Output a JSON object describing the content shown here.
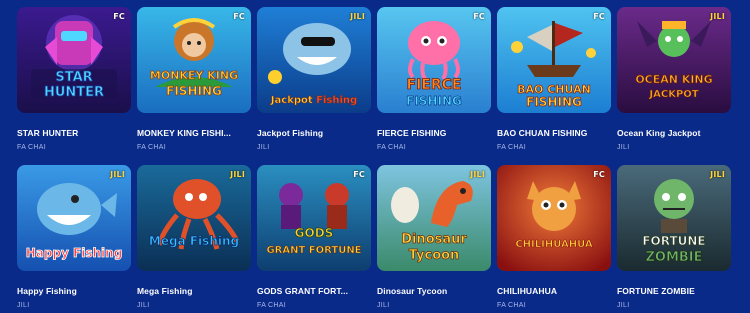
{
  "games": [
    {
      "title": "STAR HUNTER",
      "provider": "FA CHAI",
      "badge": "FC",
      "logo_line1": "STAR",
      "logo_line2": "HUNTER",
      "colors": {
        "bg1": "#3b1a8f",
        "bg2": "#1a0f4a",
        "accent": "#e64bd6",
        "logo": "#4fd8ff"
      }
    },
    {
      "title": "MONKEY KING FISHI...",
      "provider": "FA CHAI",
      "badge": "FC",
      "logo_line1": "MONKEY KING",
      "logo_line2": "FISHING",
      "colors": {
        "bg1": "#38b7e8",
        "bg2": "#1a6dc0",
        "accent": "#c9762a",
        "logo": "#ffd23a"
      }
    },
    {
      "title": "Jackpot Fishing",
      "provider": "JILI",
      "badge": "JILI",
      "logo_line1": "Jackpot",
      "logo_line2": "Fishing",
      "colors": {
        "bg1": "#1f7fd6",
        "bg2": "#0b3c8a",
        "accent": "#8ec3e8",
        "logo": "#ffcf2e"
      }
    },
    {
      "title": "FIERCE FISHING",
      "provider": "FA CHAI",
      "badge": "FC",
      "logo_line1": "FIERCE",
      "logo_line2": "FISHING",
      "colors": {
        "bg1": "#57c6f0",
        "bg2": "#2a7fd0",
        "accent": "#ff6fa8",
        "logo": "#ff8a1f"
      }
    },
    {
      "title": "BAO CHUAN FISHING",
      "provider": "FA CHAI",
      "badge": "FC",
      "logo_line1": "BAO CHUAN",
      "logo_line2": "FISHING",
      "colors": {
        "bg1": "#4fc3f0",
        "bg2": "#1c7ed2",
        "accent": "#b3271e",
        "logo": "#ffd23a"
      }
    },
    {
      "title": "Ocean King Jackpot",
      "provider": "JILI",
      "badge": "JILI",
      "logo_line1": "OCEAN KING",
      "logo_line2": "JACKPOT",
      "colors": {
        "bg1": "#6a2a8a",
        "bg2": "#2a0d40",
        "accent": "#58c05a",
        "logo": "#ffb32a"
      }
    },
    {
      "title": "Happy Fishing",
      "provider": "JILI",
      "badge": "JILI",
      "logo_line1": "Happy",
      "logo_line2": "Fishing",
      "colors": {
        "bg1": "#3a9ae6",
        "bg2": "#1550b0",
        "accent": "#6bb8e8",
        "logo": "#ff3b3b"
      }
    },
    {
      "title": "Mega Fishing",
      "provider": "JILI",
      "badge": "JILI",
      "logo_line1": "Mega",
      "logo_line2": "Fishing",
      "colors": {
        "bg1": "#1a6a9a",
        "bg2": "#0b2f55",
        "accent": "#e0512a",
        "logo": "#3ac0ff"
      }
    },
    {
      "title": "GODS GRANT FORT...",
      "provider": "FA CHAI",
      "badge": "FC",
      "logo_line1": "GODS",
      "logo_line2": "GRANT FORTUNE",
      "colors": {
        "bg1": "#2a8fc0",
        "bg2": "#0e3e70",
        "accent": "#7a2a9a",
        "logo": "#ffd23a"
      }
    },
    {
      "title": "Dinosaur Tycoon",
      "provider": "JILI",
      "badge": "JILI",
      "logo_line1": "Dinosaur",
      "logo_line2": "Tycoon",
      "colors": {
        "bg1": "#7ec4e0",
        "bg2": "#3a8a6a",
        "accent": "#e8602a",
        "logo": "#ffd23a"
      }
    },
    {
      "title": "CHILIHUAHUA",
      "provider": "FA CHAI",
      "badge": "FC",
      "logo_line1": "CHILIHUAHUA",
      "logo_line2": "",
      "colors": {
        "bg1": "#e83a2a",
        "bg2": "#8a1010",
        "accent": "#f0a040",
        "logo": "#ffd23a"
      }
    },
    {
      "title": "FORTUNE ZOMBIE",
      "provider": "JILI",
      "badge": "JILI",
      "logo_line1": "FORTUNE",
      "logo_line2": "ZOMBIE",
      "colors": {
        "bg1": "#4a6a7a",
        "bg2": "#1a2a30",
        "accent": "#6fb56a",
        "logo": "#ffffff"
      }
    }
  ]
}
